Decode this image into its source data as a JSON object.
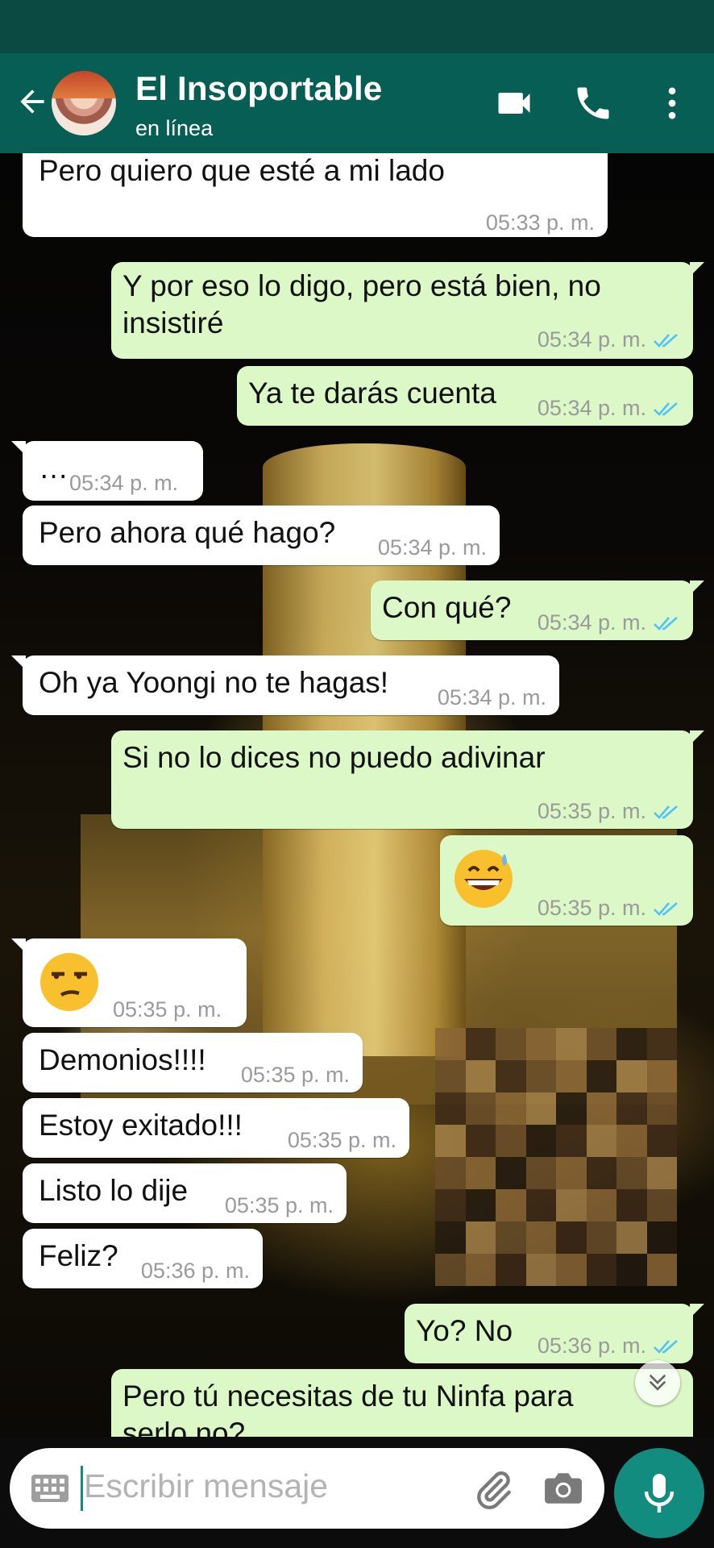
{
  "header": {
    "contact_name": "El Insoportable",
    "status": "en línea",
    "icons": [
      "back-arrow-icon",
      "video-call-icon",
      "phone-icon",
      "more-vert-icon"
    ],
    "color": "#075e54"
  },
  "messages": [
    {
      "dir": "in",
      "text": "Pero quiero que esté a mi lado",
      "time": "05:33 p. m."
    },
    {
      "dir": "out",
      "text": "Y por eso lo digo, pero está bien, no",
      "text2": "insistiré",
      "time": "05:34 p. m.",
      "read": true
    },
    {
      "dir": "out",
      "text": "Ya te darás cuenta",
      "time": "05:34 p. m.",
      "read": true
    },
    {
      "dir": "in",
      "text": "…",
      "time": "05:34 p. m."
    },
    {
      "dir": "in",
      "text": "Pero ahora qué hago?",
      "time": "05:34 p. m."
    },
    {
      "dir": "out",
      "text": "Con qué?",
      "time": "05:34 p. m.",
      "read": true
    },
    {
      "dir": "in",
      "text": "Oh ya Yoongi no te hagas!",
      "time": "05:34 p. m."
    },
    {
      "dir": "out",
      "text": "Si no lo dices no puedo adivinar",
      "time": "05:35 p. m.",
      "read": true
    },
    {
      "dir": "out",
      "emoji": "grinning-face-with-sweat",
      "time": "05:35 p. m.",
      "read": true
    },
    {
      "dir": "in",
      "emoji": "unamused-face",
      "time": "05:35 p. m."
    },
    {
      "dir": "in",
      "text": "Demonios!!!!",
      "time": "05:35 p. m."
    },
    {
      "dir": "in",
      "text": "Estoy exitado!!!",
      "time": "05:35 p. m."
    },
    {
      "dir": "in",
      "text": "Listo lo dije",
      "time": "05:35 p. m."
    },
    {
      "dir": "in",
      "text": "Feliz?",
      "time": "05:36 p. m."
    },
    {
      "dir": "out",
      "text": "Yo? No",
      "time": "05:36 p. m.",
      "read": true
    },
    {
      "dir": "out",
      "text": "Pero tú necesitas de tu Ninfa para",
      "text2": "serlo no?"
    }
  ],
  "input": {
    "placeholder": "Escribir mensaje",
    "icons": [
      "keyboard-icon",
      "attach-icon",
      "camera-icon",
      "mic-icon"
    ]
  },
  "colors": {
    "accent": "#128c7e",
    "incoming": "#ffffff",
    "outgoing": "#dcf8c6",
    "read_ticks": "#4fc3f7"
  }
}
